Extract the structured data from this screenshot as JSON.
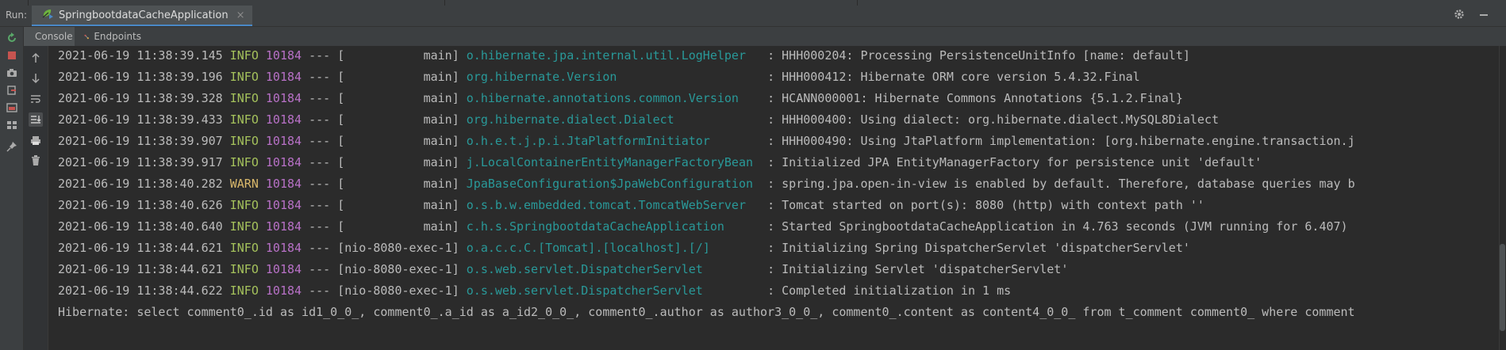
{
  "run_bar": {
    "label": "Run:",
    "tab_label": "SpringbootdataCacheApplication",
    "tab_close": "×"
  },
  "subtabs": {
    "console": "Console",
    "endpoints": "Endpoints"
  },
  "log_lines": [
    {
      "ts": "2021-06-19 11:38:39.145",
      "level": "INFO",
      "pid": "10184",
      "sep": " --- ",
      "thread": "[           main]",
      "logger": "o.hibernate.jpa.internal.util.LogHelper  ",
      "msg": ": HHH000204: Processing PersistenceUnitInfo [name: default]"
    },
    {
      "ts": "2021-06-19 11:38:39.196",
      "level": "INFO",
      "pid": "10184",
      "sep": " --- ",
      "thread": "[           main]",
      "logger": "org.hibernate.Version                    ",
      "msg": ": HHH000412: Hibernate ORM core version 5.4.32.Final"
    },
    {
      "ts": "2021-06-19 11:38:39.328",
      "level": "INFO",
      "pid": "10184",
      "sep": " --- ",
      "thread": "[           main]",
      "logger": "o.hibernate.annotations.common.Version   ",
      "msg": ": HCANN000001: Hibernate Commons Annotations {5.1.2.Final}"
    },
    {
      "ts": "2021-06-19 11:38:39.433",
      "level": "INFO",
      "pid": "10184",
      "sep": " --- ",
      "thread": "[           main]",
      "logger": "org.hibernate.dialect.Dialect            ",
      "msg": ": HHH000400: Using dialect: org.hibernate.dialect.MySQL8Dialect"
    },
    {
      "ts": "2021-06-19 11:38:39.907",
      "level": "INFO",
      "pid": "10184",
      "sep": " --- ",
      "thread": "[           main]",
      "logger": "o.h.e.t.j.p.i.JtaPlatformInitiator       ",
      "msg": ": HHH000490: Using JtaPlatform implementation: [org.hibernate.engine.transaction.j"
    },
    {
      "ts": "2021-06-19 11:38:39.917",
      "level": "INFO",
      "pid": "10184",
      "sep": " --- ",
      "thread": "[           main]",
      "logger": "j.LocalContainerEntityManagerFactoryBean ",
      "msg": ": Initialized JPA EntityManagerFactory for persistence unit 'default'"
    },
    {
      "ts": "2021-06-19 11:38:40.282",
      "level": "WARN",
      "pid": "10184",
      "sep": " --- ",
      "thread": "[           main]",
      "logger": "JpaBaseConfiguration$JpaWebConfiguration ",
      "msg": ": spring.jpa.open-in-view is enabled by default. Therefore, database queries may b"
    },
    {
      "ts": "2021-06-19 11:38:40.626",
      "level": "INFO",
      "pid": "10184",
      "sep": " --- ",
      "thread": "[           main]",
      "logger": "o.s.b.w.embedded.tomcat.TomcatWebServer  ",
      "msg": ": Tomcat started on port(s): 8080 (http) with context path ''"
    },
    {
      "ts": "2021-06-19 11:38:40.640",
      "level": "INFO",
      "pid": "10184",
      "sep": " --- ",
      "thread": "[           main]",
      "logger": "c.h.s.SpringbootdataCacheApplication     ",
      "msg": ": Started SpringbootdataCacheApplication in 4.763 seconds (JVM running for 6.407)"
    },
    {
      "ts": "2021-06-19 11:38:44.621",
      "level": "INFO",
      "pid": "10184",
      "sep": " --- ",
      "thread": "[nio-8080-exec-1]",
      "logger": "o.a.c.c.C.[Tomcat].[localhost].[/]       ",
      "msg": ": Initializing Spring DispatcherServlet 'dispatcherServlet'"
    },
    {
      "ts": "2021-06-19 11:38:44.621",
      "level": "INFO",
      "pid": "10184",
      "sep": " --- ",
      "thread": "[nio-8080-exec-1]",
      "logger": "o.s.web.servlet.DispatcherServlet        ",
      "msg": ": Initializing Servlet 'dispatcherServlet'"
    },
    {
      "ts": "2021-06-19 11:38:44.622",
      "level": "INFO",
      "pid": "10184",
      "sep": " --- ",
      "thread": "[nio-8080-exec-1]",
      "logger": "o.s.web.servlet.DispatcherServlet        ",
      "msg": ": Completed initialization in 1 ms"
    }
  ],
  "hibernate_line": "Hibernate: select comment0_.id as id1_0_0_, comment0_.a_id as a_id2_0_0_, comment0_.author as author3_0_0_, comment0_.content as content4_0_0_ from t_comment comment0_ where comment",
  "icons": {
    "tab": "spring-run-icon",
    "settings": "gear-icon",
    "minimize": "minimize-icon",
    "rerun": "rerun-icon",
    "stop": "stop-icon",
    "camera": "screenshot-icon",
    "exit": "exit-icon",
    "restore": "restore-layout-icon",
    "pin": "pin-icon",
    "up": "arrow-up-icon",
    "down": "arrow-down-icon",
    "wrap": "soft-wrap-icon",
    "scroll_end": "scroll-to-end-icon",
    "print": "print-icon",
    "trash": "trash-icon"
  }
}
